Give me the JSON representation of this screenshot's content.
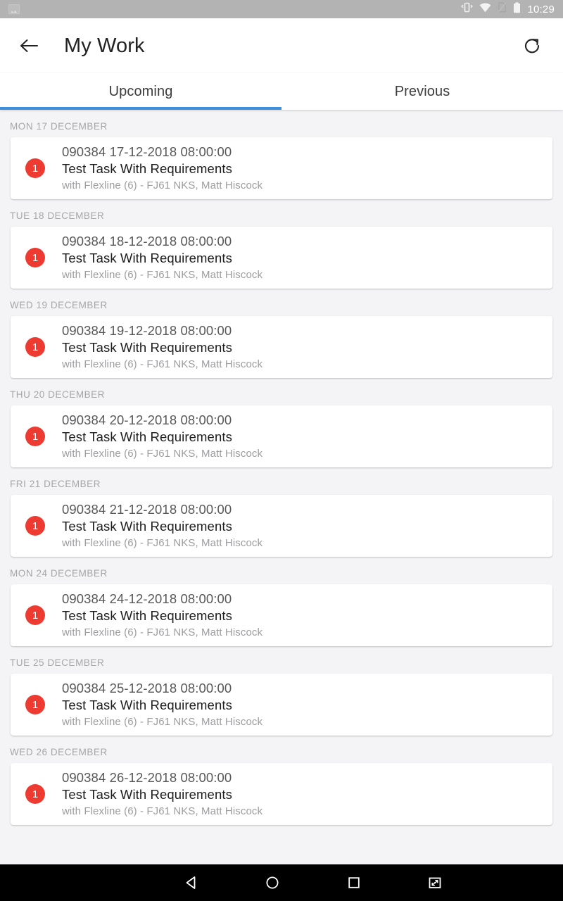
{
  "status_bar": {
    "left_icons": [
      "screenshot-image-notification-icon"
    ],
    "right_icons": [
      "vibrate-icon",
      "wifi-icon",
      "sim-card-off-icon",
      "battery-full-icon"
    ],
    "clock": "10:29",
    "background_color": "#b3b3b3"
  },
  "app_bar": {
    "back_icon": "arrow-left-icon",
    "title": "My Work",
    "refresh_icon": "refresh-icon",
    "background_color": "#ffffff"
  },
  "tabs": {
    "items": [
      {
        "label": "Upcoming",
        "selected": true
      },
      {
        "label": "Previous",
        "selected": false
      }
    ],
    "indicator_color": "#3f8edc"
  },
  "list": {
    "groups": [
      {
        "day_header": "MON 17 DECEMBER",
        "items": [
          {
            "badge": "1",
            "reference": "090384 17-12-2018 08:00:00",
            "title": "Test Task With Requirements",
            "subtitle": "with Flexline (6) - FJ61 NKS, Matt Hiscock"
          }
        ]
      },
      {
        "day_header": "TUE 18 DECEMBER",
        "items": [
          {
            "badge": "1",
            "reference": "090384 18-12-2018 08:00:00",
            "title": "Test Task With Requirements",
            "subtitle": "with Flexline (6) - FJ61 NKS, Matt Hiscock"
          }
        ]
      },
      {
        "day_header": "WED 19 DECEMBER",
        "items": [
          {
            "badge": "1",
            "reference": "090384 19-12-2018 08:00:00",
            "title": "Test Task With Requirements",
            "subtitle": "with Flexline (6) - FJ61 NKS, Matt Hiscock"
          }
        ]
      },
      {
        "day_header": "THU 20 DECEMBER",
        "items": [
          {
            "badge": "1",
            "reference": "090384 20-12-2018 08:00:00",
            "title": "Test Task With Requirements",
            "subtitle": "with Flexline (6) - FJ61 NKS, Matt Hiscock"
          }
        ]
      },
      {
        "day_header": "FRI 21 DECEMBER",
        "items": [
          {
            "badge": "1",
            "reference": "090384 21-12-2018 08:00:00",
            "title": "Test Task With Requirements",
            "subtitle": "with Flexline (6) - FJ61 NKS, Matt Hiscock"
          }
        ]
      },
      {
        "day_header": "MON 24 DECEMBER",
        "items": [
          {
            "badge": "1",
            "reference": "090384 24-12-2018 08:00:00",
            "title": "Test Task With Requirements",
            "subtitle": "with Flexline (6) - FJ61 NKS, Matt Hiscock"
          }
        ]
      },
      {
        "day_header": "TUE 25 DECEMBER",
        "items": [
          {
            "badge": "1",
            "reference": "090384 25-12-2018 08:00:00",
            "title": "Test Task With Requirements",
            "subtitle": "with Flexline (6) - FJ61 NKS, Matt Hiscock"
          }
        ]
      },
      {
        "day_header": "WED 26 DECEMBER",
        "items": [
          {
            "badge": "1",
            "reference": "090384 26-12-2018 08:00:00",
            "title": "Test Task With Requirements",
            "subtitle": "with Flexline (6) - FJ61 NKS, Matt Hiscock"
          }
        ]
      }
    ],
    "background_color": "#f4f4f6",
    "badge_color": "#ee3b31"
  },
  "nav_bar": {
    "buttons": [
      "back-triangle-icon",
      "home-circle-icon",
      "recents-square-icon",
      "resize-window-icon"
    ],
    "background_color": "#000000"
  }
}
